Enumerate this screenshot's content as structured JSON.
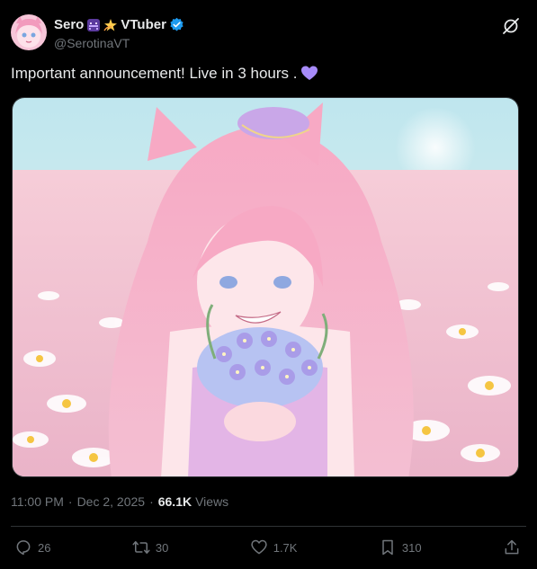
{
  "author": {
    "display_name": "Sero",
    "name_suffix": "VTuber",
    "handle": "@SerotinaVT",
    "emojis": [
      "space-invader-emoji",
      "dizzy-star-emoji"
    ],
    "verified": true,
    "verified_color": "#1d9bf0"
  },
  "tweet": {
    "text": "Important announcement! Live in 3 hours .",
    "text_emoji": "purple-heart-emoji"
  },
  "meta": {
    "time": "11:00 PM",
    "date": "Dec 2, 2025",
    "separator": "·",
    "views_count": "66.1K",
    "views_label": "Views"
  },
  "actions": {
    "replies": "26",
    "reposts": "30",
    "likes": "1.7K",
    "bookmarks": "310"
  },
  "colors": {
    "background": "#000000",
    "text": "#e7e9ea",
    "muted": "#71767b",
    "border": "#2f3336",
    "accent_purple": "#a78bfa"
  }
}
